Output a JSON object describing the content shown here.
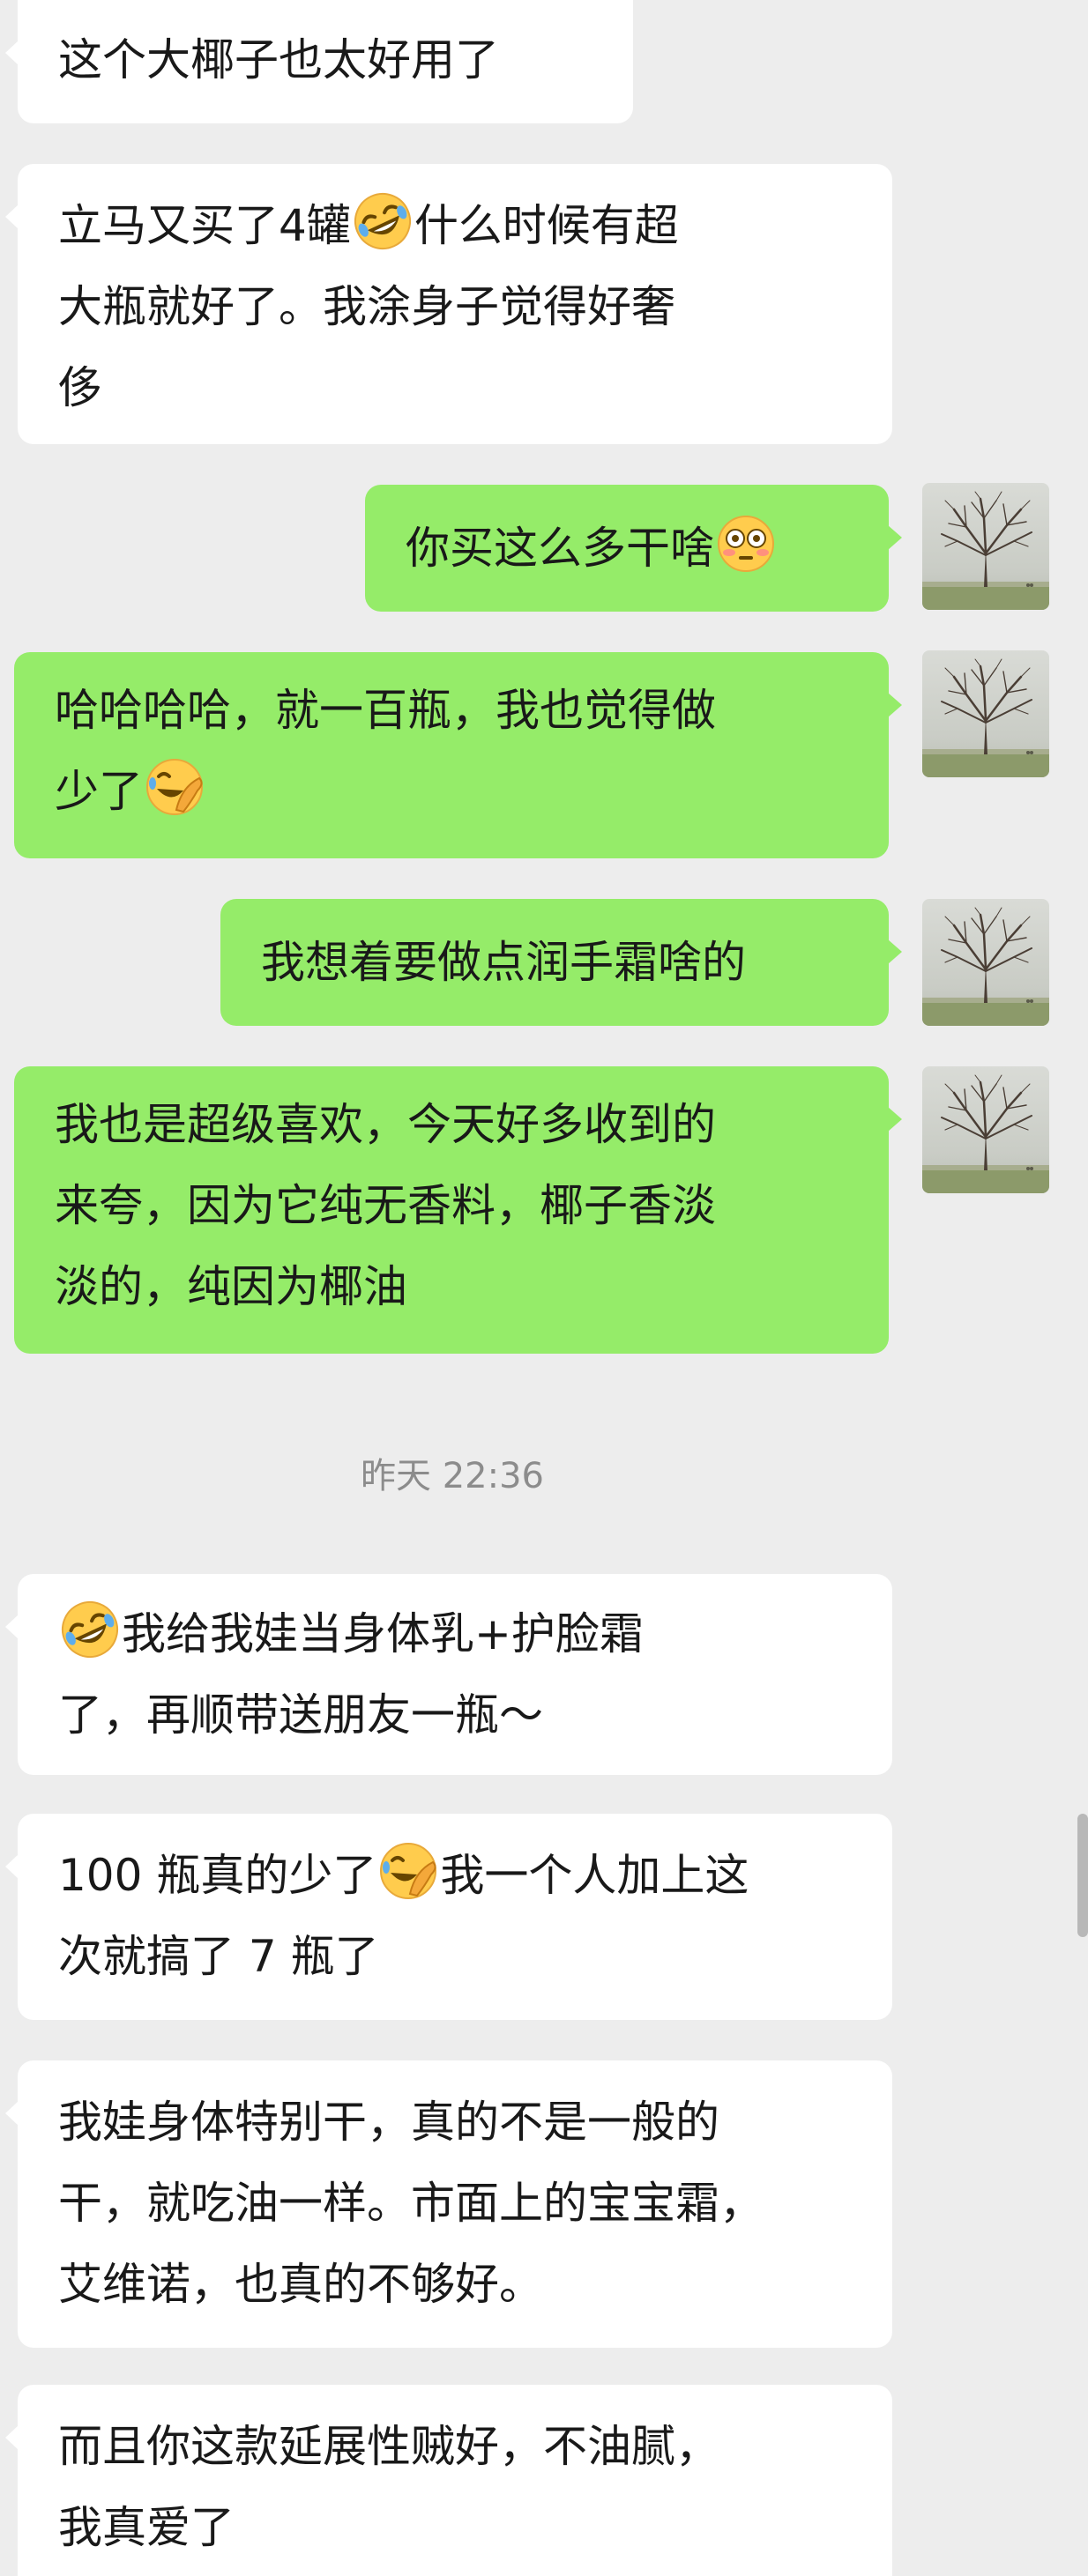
{
  "messages": [
    {
      "side": "in",
      "lines": [
        [
          "这个大椰子也太好用了"
        ]
      ]
    },
    {
      "side": "in",
      "lines": [
        [
          "立马又买了4罐",
          {
            "emoji": "rofl-emoji"
          },
          "什么时候有超"
        ],
        [
          "大瓶就好了。我涂身子觉得好奢"
        ],
        [
          "侈"
        ]
      ]
    },
    {
      "side": "out",
      "lines": [
        [
          "你买这么多干啥",
          {
            "emoji": "flushed-emoji"
          }
        ]
      ]
    },
    {
      "side": "out",
      "lines": [
        [
          "哈哈哈哈，就一百瓶，我也觉得做"
        ],
        [
          "少了",
          {
            "emoji": "facepalm-laugh-emoji"
          }
        ]
      ]
    },
    {
      "side": "out",
      "lines": [
        [
          "我想着要做点润手霜啥的"
        ]
      ]
    },
    {
      "side": "out",
      "lines": [
        [
          "我也是超级喜欢，今天好多收到的"
        ],
        [
          "来夸，因为它纯无香料，椰子香淡"
        ],
        [
          "淡的，纯因为椰油"
        ]
      ]
    },
    {
      "side": "in",
      "lines": [
        [
          {
            "emoji": "rofl-emoji"
          },
          "我给我娃当身体乳+护脸霜"
        ],
        [
          "了，再顺带送朋友一瓶～"
        ]
      ]
    },
    {
      "side": "in",
      "lines": [
        [
          "100 瓶真的少了",
          {
            "emoji": "facepalm-laugh-emoji"
          },
          "我一个人加上这"
        ],
        [
          "次就搞了 7 瓶了"
        ]
      ]
    },
    {
      "side": "in",
      "lines": [
        [
          "我娃身体特别干，真的不是一般的"
        ],
        [
          "干，就吃油一样。市面上的宝宝霜，"
        ],
        [
          "艾维诺，也真的不够好。"
        ]
      ]
    },
    {
      "side": "in",
      "lines": [
        [
          "而且你这款延展性贼好，不油腻，"
        ],
        [
          "我真爱了"
        ]
      ]
    }
  ],
  "timestamp": "昨天 22:36",
  "colors": {
    "background": "#ededed",
    "incoming_bubble": "#ffffff",
    "outgoing_bubble": "#95ec69",
    "text": "#191919",
    "timestamp": "#8c8c8c"
  },
  "avatar_icon": "bare-tree-avatar-icon"
}
